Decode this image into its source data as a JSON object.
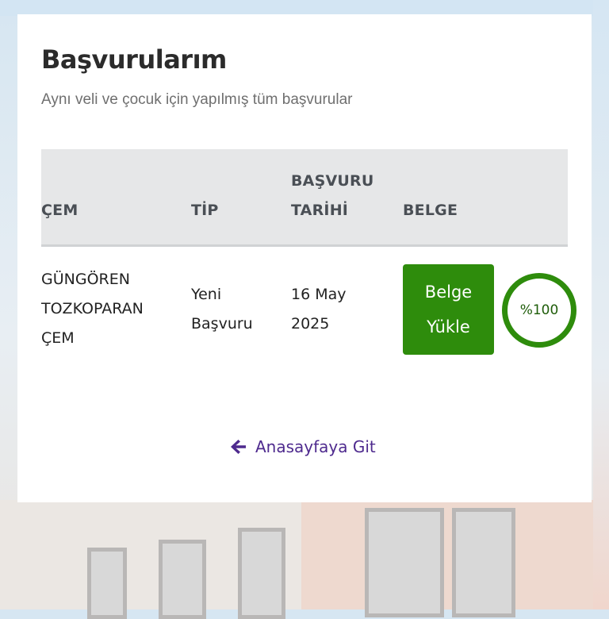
{
  "page": {
    "title": "Başvurularım",
    "subtitle": "Aynı veli ve çocuk için yapılmış tüm başvurular"
  },
  "table": {
    "headers": {
      "name": "ÇEM",
      "type": "TİP",
      "date_line1": "BAŞVURU",
      "date_line2": "TARİHİ",
      "document": "BELGE"
    },
    "rows": [
      {
        "name_lines": [
          "GÜNGÖREN",
          "TOZKOPARAN",
          "ÇEM"
        ],
        "type_lines": [
          "Yeni",
          "Başvuru"
        ],
        "date_lines": [
          "16 May",
          "2025"
        ],
        "upload_button_lines": [
          "Belge",
          "Yükle"
        ],
        "progress_label": "%100",
        "progress_value": 1.0
      }
    ]
  },
  "footer": {
    "home_link_label": "Anasayfaya Git",
    "home_link_icon": "arrow-left-icon"
  },
  "colors": {
    "accent_green": "#2e8c0c",
    "link_purple": "#4e2a8e",
    "header_bg": "#e6e7e8"
  }
}
